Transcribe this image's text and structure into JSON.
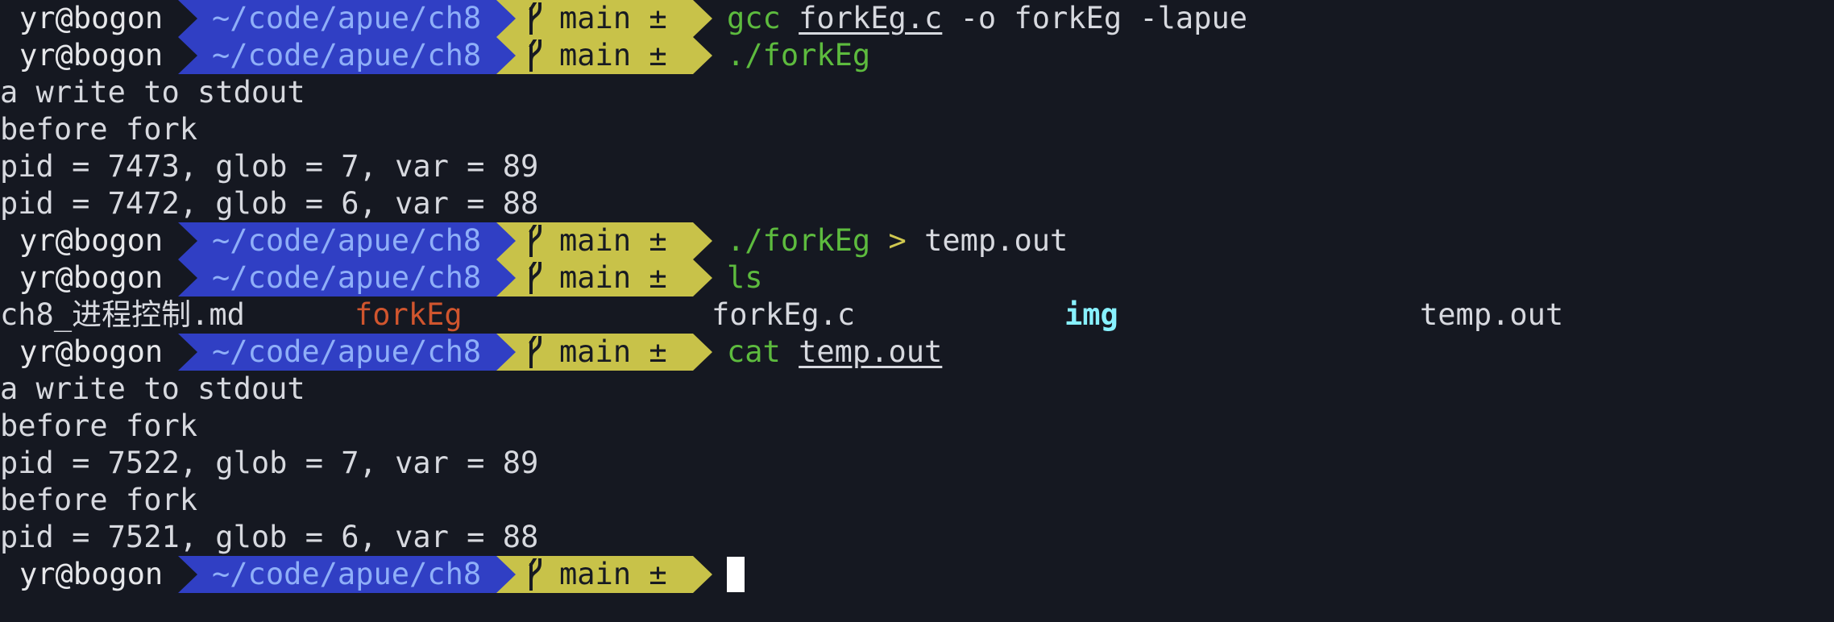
{
  "terminal": {
    "prompt": {
      "user_host": "yr@bogon",
      "path": "~/code/apue/ch8",
      "branch": "main ±"
    },
    "commands": {
      "cmd1": {
        "program": "gcc",
        "arg_file": "forkEg.c",
        "rest": "-o forkEg -lapue"
      },
      "cmd2": {
        "text": "./forkEg"
      },
      "cmd3": {
        "program": "./forkEg",
        "redirect": ">",
        "target": "temp.out"
      },
      "cmd4": {
        "text": "ls"
      },
      "cmd5": {
        "program": "cat",
        "arg_file": "temp.out"
      }
    },
    "output_run1": [
      "a write to stdout",
      "before fork",
      "pid = 7473, glob = 7, var = 89",
      "pid = 7472, glob = 6, var = 88"
    ],
    "ls_output": [
      "ch8_进程控制.md",
      "forkEg",
      "forkEg.c",
      "img",
      "temp.out"
    ],
    "output_cat": [
      "a write to stdout",
      "before fork",
      "pid = 7522, glob = 7, var = 89",
      "before fork",
      "pid = 7521, glob = 6, var = 88"
    ]
  },
  "colors": {
    "background": "#151821",
    "path_segment": "#303fc4",
    "git_segment": "#c8c249",
    "command_green": "#5dbb3e",
    "executable_red": "#d0552e",
    "directory_cyan": "#88f1ff"
  },
  "icons": {
    "branch": "git-branch-icon",
    "cursor": "block-cursor"
  }
}
